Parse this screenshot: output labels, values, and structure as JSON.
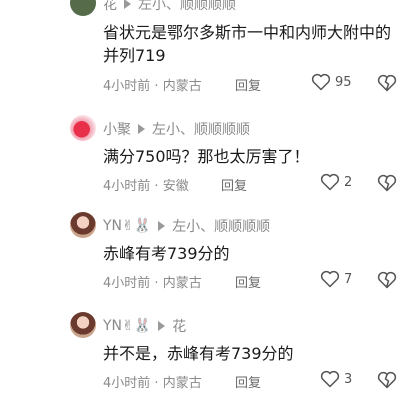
{
  "comments": [
    {
      "user": "花",
      "text": "省状元是鄂尔多斯市一中和内师大附中的并列719",
      "time": "4小时前",
      "location": "内蒙古",
      "reply_label": "回复",
      "likes": "95"
    },
    {
      "user": "小聚",
      "reply_to": "左小、顺顺顺顺",
      "text": "满分750吗？那也太厉害了！",
      "time": "4小时前",
      "location": "安徽",
      "reply_label": "回复",
      "likes": "2"
    },
    {
      "user": "YN✌🐰",
      "reply_to": "左小、顺顺顺顺",
      "text": "赤峰有考739分的",
      "time": "4小时前",
      "location": "内蒙古",
      "reply_label": "回复",
      "likes": "7"
    },
    {
      "user": "YN✌🐰",
      "reply_to": "花",
      "text": "并不是，赤峰有考739分的",
      "time": "4小时前",
      "location": "内蒙古",
      "reply_label": "回复",
      "likes": "3"
    }
  ],
  "top_partial": {
    "user": "花",
    "reply_to": "左小、顺顺顺顺"
  },
  "separator": "·"
}
